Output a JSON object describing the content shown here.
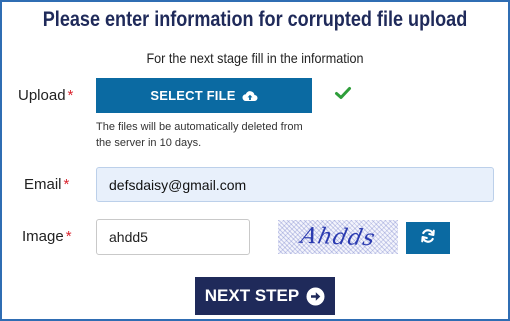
{
  "form": {
    "title": "Please enter information for corrupted file upload",
    "subtitle": "For the next stage fill in the information",
    "required_mark": "*"
  },
  "upload": {
    "label": "Upload",
    "button_label": "SELECT FILE",
    "button_icon": "cloud-upload-icon",
    "status_icon": "checkmark-icon",
    "note": "The files will be automatically deleted from the server in 10 days."
  },
  "email": {
    "label": "Email",
    "value": "defsdaisy@gmail.com"
  },
  "image": {
    "label": "Image",
    "value": "ahdd5",
    "captcha_text": "Ahdds",
    "refresh_icon": "refresh-icon"
  },
  "next": {
    "label": "NEXT STEP",
    "icon": "arrow-circle-right-icon"
  },
  "colors": {
    "title": "#1f2a5a",
    "primary_button": "#0b6aa2",
    "next_button": "#1f2a5a",
    "required": "#d9232d",
    "check": "#2e9e3a",
    "email_bg": "#e8f0fb",
    "frame_border": "#2f6db3"
  }
}
